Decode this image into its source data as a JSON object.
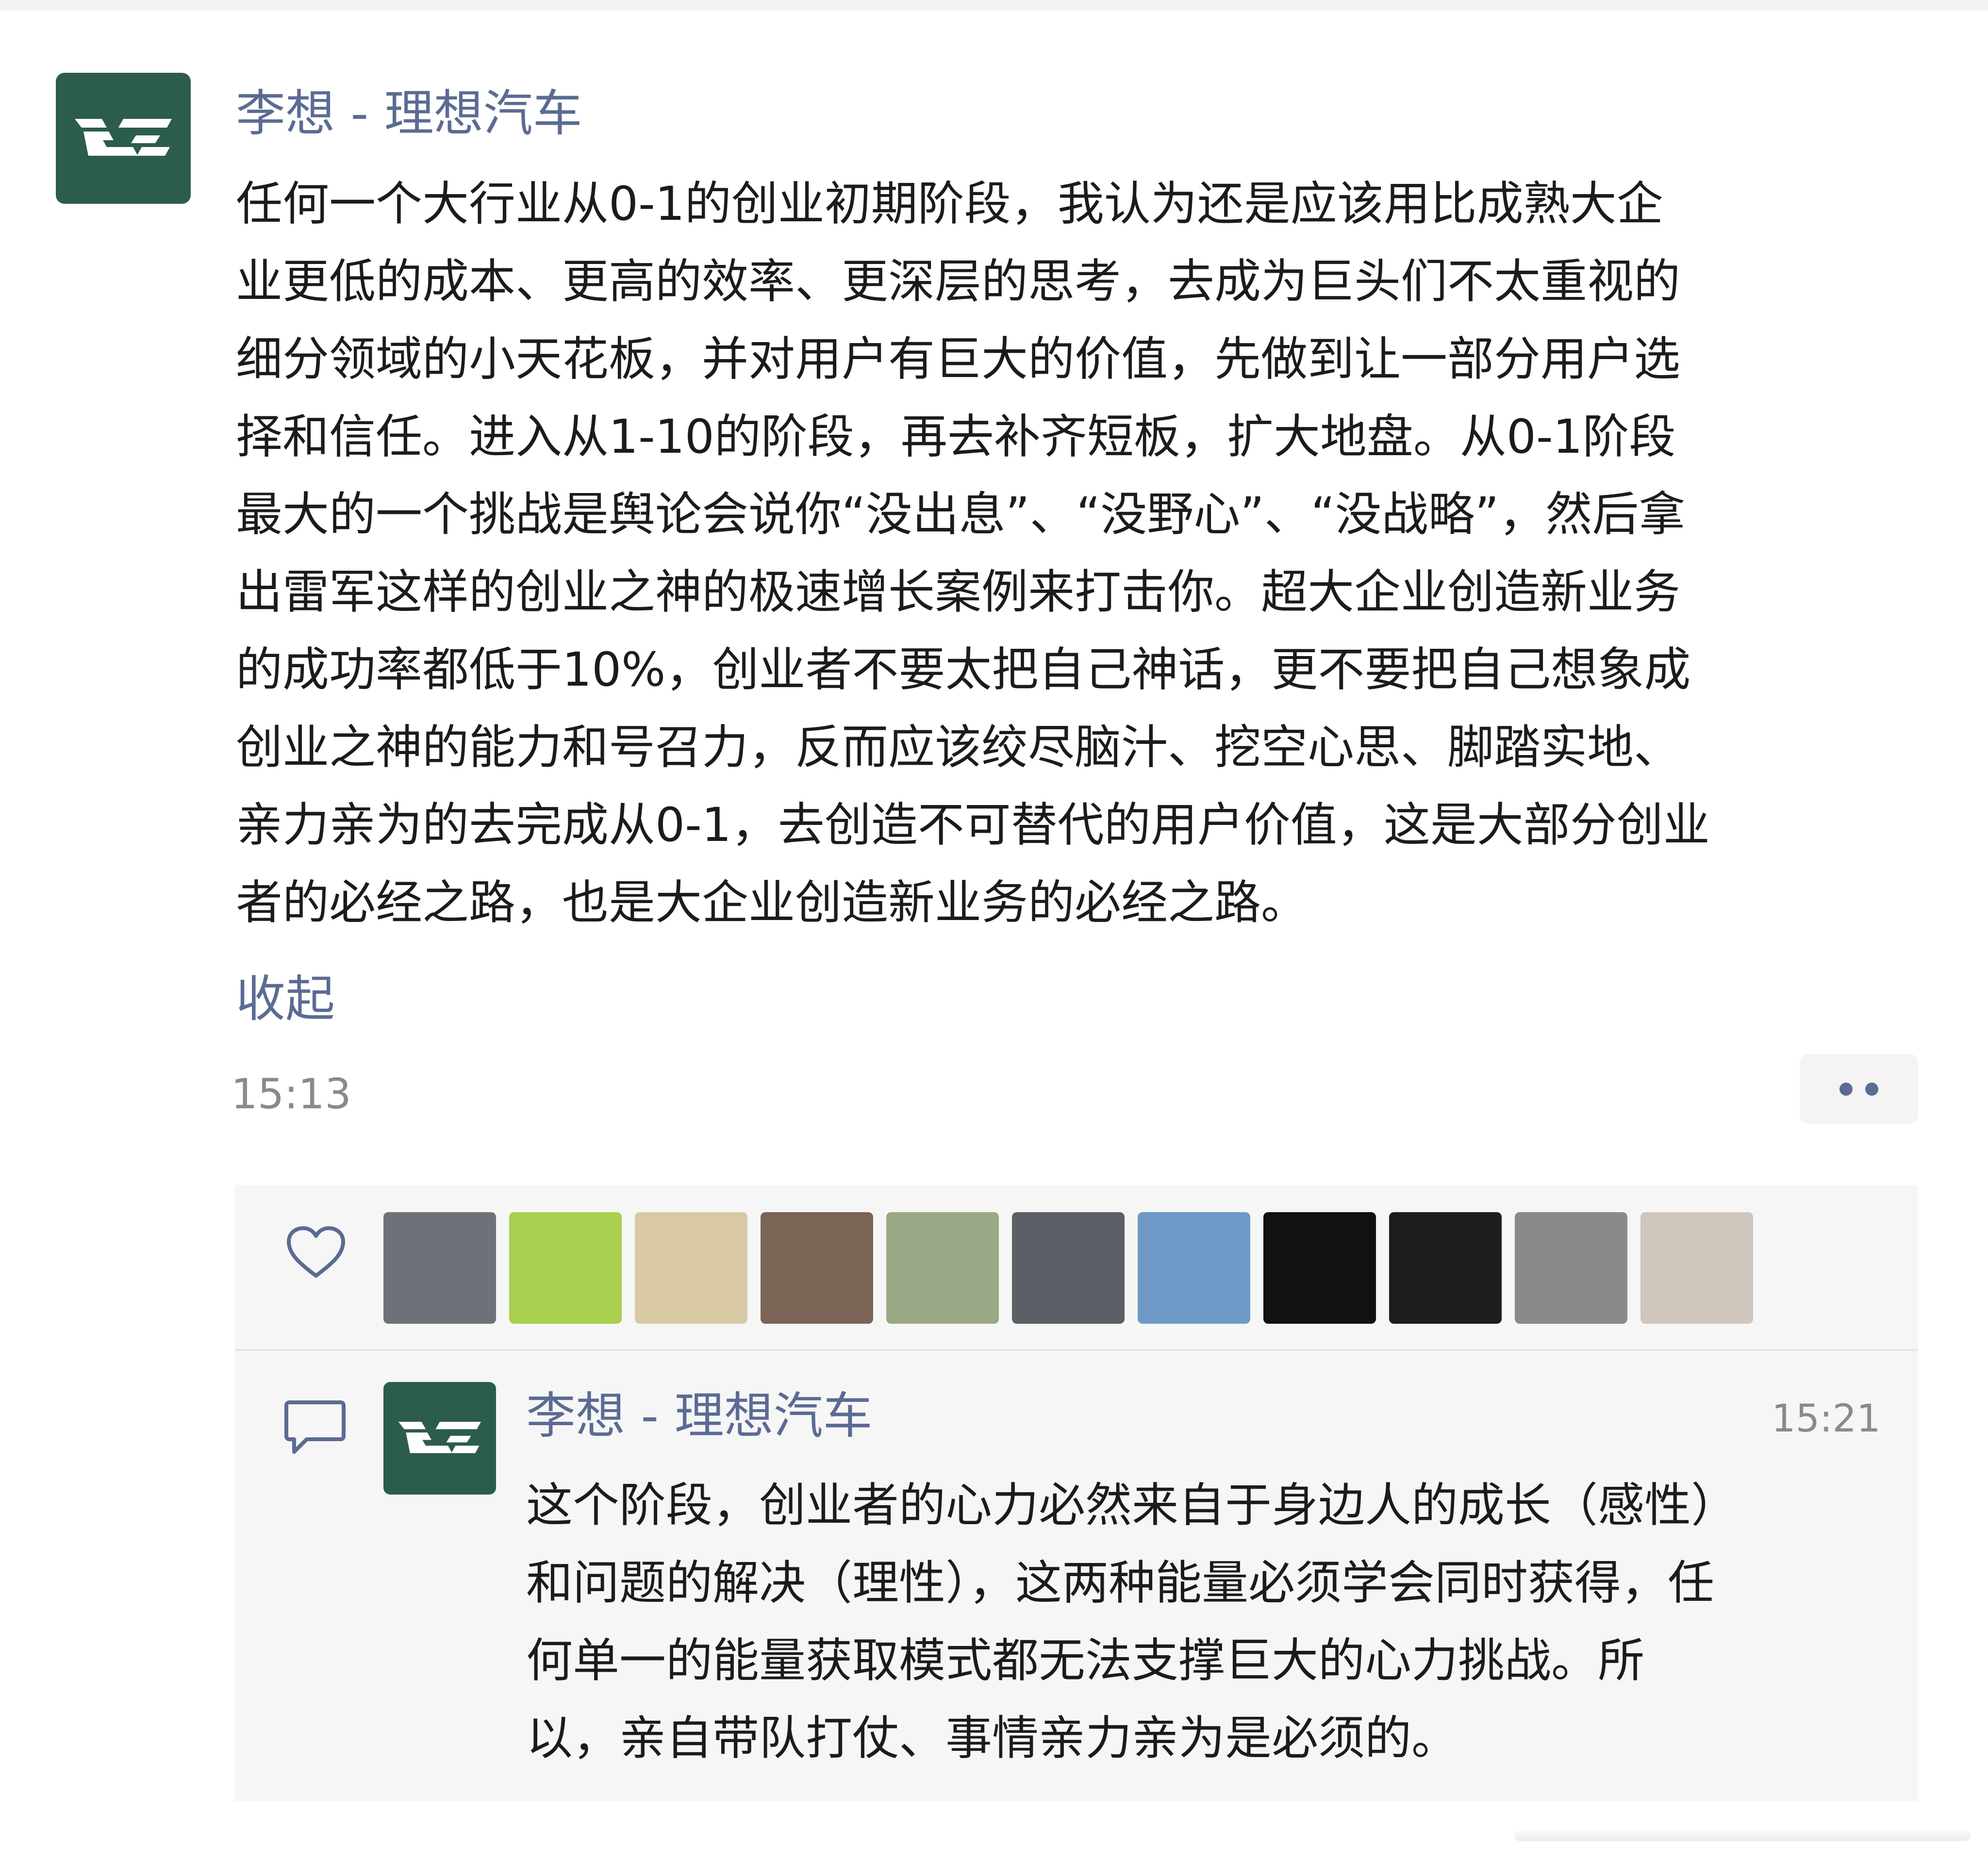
{
  "post": {
    "author": "李想 - 理想汽车",
    "body_lines": [
      "任何一个大行业从0-1的创业初期阶段，我认为还是应该用比成熟大企",
      "业更低的成本、更高的效率、更深层的思考，去成为巨头们不太重视的",
      "细分领域的小天花板，并对用户有巨大的价值，先做到让一部分用户选",
      "择和信任。进入从1-10的阶段，再去补齐短板，扩大地盘。从0-1阶段",
      "最大的一个挑战是舆论会说你“没出息”、“没野心”、“没战略”，然后拿",
      "出雷军这样的创业之神的极速增长案例来打击你。超大企业创造新业务",
      "的成功率都低于10%，创业者不要太把自己神话，更不要把自己想象成",
      "创业之神的能力和号召力，反而应该绞尽脑汁、挖空心思、脚踏实地、",
      "亲力亲为的去完成从0-1，去创造不可替代的用户价值，这是大部分创业",
      "者的必经之路，也是大企业创造新业务的必经之路。"
    ],
    "collapse_label": "收起",
    "time": "15:13"
  },
  "likes": {
    "icon": "heart-icon",
    "avatars": [
      {
        "name": "liker-car",
        "color": "#6d7278"
      },
      {
        "name": "liker-green",
        "color": "#a9cf4e"
      },
      {
        "name": "liker-dog",
        "color": "#d9c8a4"
      },
      {
        "name": "liker-man-flowers",
        "color": "#7a6455"
      },
      {
        "name": "liker-woman-sunglasses",
        "color": "#9aa886"
      },
      {
        "name": "liker-man-portrait",
        "color": "#5b6066"
      },
      {
        "name": "liker-lake",
        "color": "#6f9ac8"
      },
      {
        "name": "liker-apple-logo",
        "color": "#111111"
      },
      {
        "name": "liker-statue",
        "color": "#1d1d1d"
      },
      {
        "name": "liker-cat",
        "color": "#8a8a8a"
      },
      {
        "name": "liker-woman-standing",
        "color": "#cfc7bd"
      }
    ]
  },
  "comment": {
    "icon": "comment-bubble-icon",
    "author": "李想 - 理想汽车",
    "time": "15:21",
    "body_lines": [
      "这个阶段，创业者的心力必然来自于身边人的成长（感性）",
      "和问题的解决（理性），这两种能量必须学会同时获得，任",
      "何单一的能量获取模式都无法支撑巨大的心力挑战。所",
      "以，亲自带队打仗、事情亲力亲为是必须的。"
    ]
  },
  "colors": {
    "brand_avatar": "#2b5c4e",
    "author_link": "#5b6b93",
    "body_text": "#1b1b1b",
    "meta_text": "#8a8a8a",
    "panel_bg": "#f6f6f6"
  }
}
